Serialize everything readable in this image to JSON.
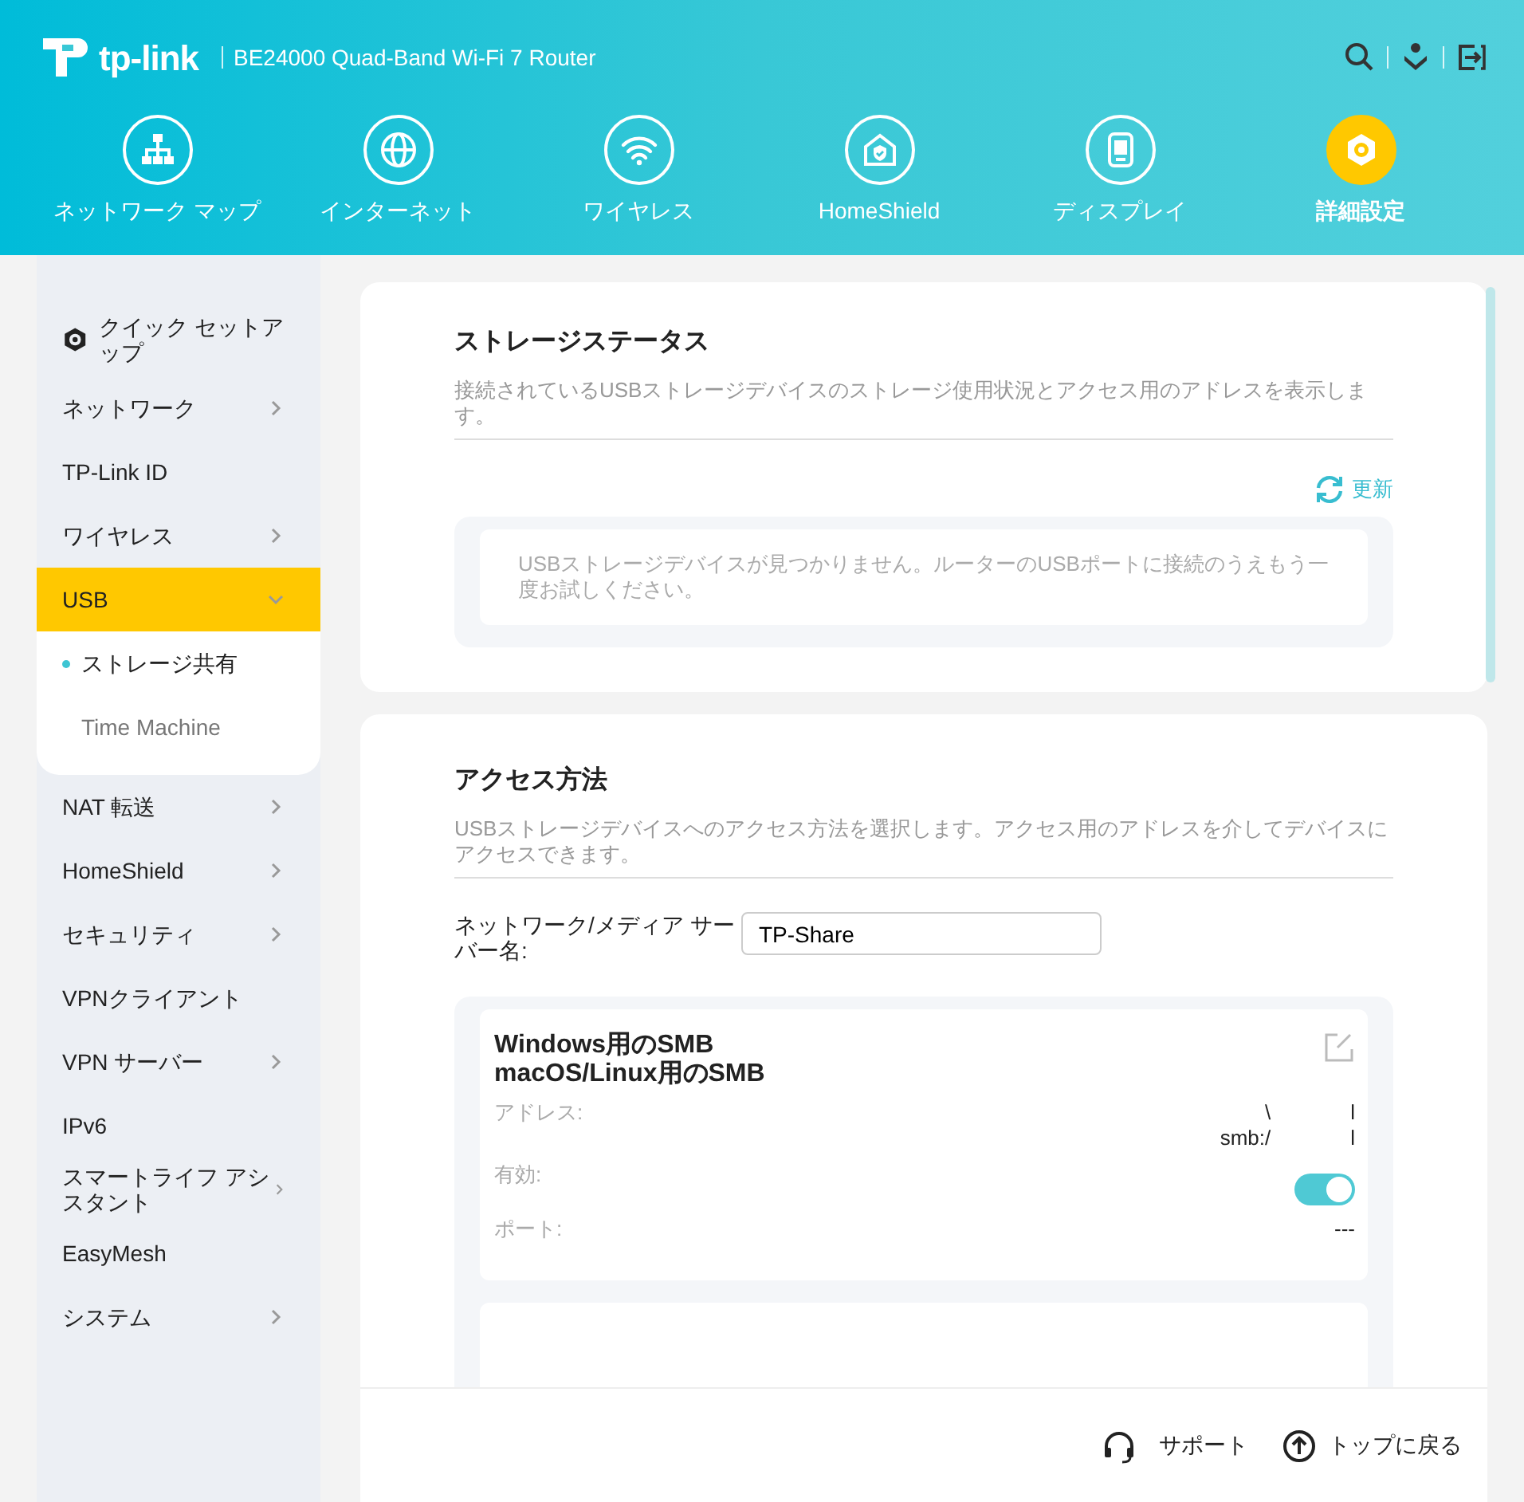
{
  "header": {
    "logo": "tp-link",
    "model": "BE24000 Quad-Band Wi-Fi 7 Router",
    "nav": [
      {
        "label": "ネットワーク マップ",
        "kind": "map",
        "selected": false
      },
      {
        "label": "インターネット",
        "kind": "globe",
        "selected": false
      },
      {
        "label": "ワイヤレス",
        "kind": "wifi",
        "selected": false
      },
      {
        "label": "HomeShield",
        "kind": "shield",
        "selected": false
      },
      {
        "label": "ディスプレイ",
        "kind": "display",
        "selected": false
      },
      {
        "label": "詳細設定",
        "kind": "gear",
        "selected": true
      }
    ]
  },
  "sidebar": {
    "items": [
      {
        "label": "クイック セットアップ",
        "kind": "setup"
      },
      {
        "label": "ネットワーク",
        "kind": "group",
        "expanded": false,
        "selected": false
      },
      {
        "label": "TP-Link ID",
        "kind": "link",
        "selected": false
      },
      {
        "label": "ワイヤレス",
        "kind": "group",
        "expanded": false,
        "selected": false
      },
      {
        "label": "USB",
        "kind": "group",
        "expanded": true,
        "selected": true,
        "children": [
          {
            "label": "ストレージ共有",
            "selected": true
          },
          {
            "label": "Time Machine",
            "selected": false
          }
        ]
      },
      {
        "label": "NAT 転送",
        "kind": "group",
        "expanded": false,
        "selected": false
      },
      {
        "label": "HomeShield",
        "kind": "group",
        "expanded": false,
        "selected": false
      },
      {
        "label": "セキュリティ",
        "kind": "group",
        "expanded": false,
        "selected": false
      },
      {
        "label": "VPNクライアント",
        "kind": "link",
        "selected": false
      },
      {
        "label": "VPN サーバー",
        "kind": "group",
        "expanded": false,
        "selected": false
      },
      {
        "label": "IPv6",
        "kind": "link",
        "selected": false
      },
      {
        "label": "スマートライフ アシスタント",
        "kind": "group",
        "expanded": false,
        "selected": false
      },
      {
        "label": "EasyMesh",
        "kind": "link",
        "selected": false
      },
      {
        "label": "システム",
        "kind": "group",
        "expanded": false,
        "selected": false
      }
    ]
  },
  "storage_status": {
    "title": "ストレージステータス",
    "description": "接続されているUSBストレージデバイスのストレージ使用状況とアクセス用のアドレスを表示します。",
    "refresh": "更新",
    "empty_message": "USBストレージデバイスが見つかりません。ルーターのUSBポートに接続のうえもう一度お試しください。"
  },
  "access_method": {
    "title": "アクセス方法",
    "description": "USBストレージデバイスへのアクセス方法を選択します。アクセス用のアドレスを介してデバイスにアクセスできます。",
    "server_name_label": "ネットワーク/メディア サーバー名:",
    "server_name": "TP-Share",
    "methods": [
      {
        "title_lines": [
          "Windows用のSMB",
          "macOS/Linux用のSMB"
        ],
        "address_label": "アドレス:",
        "address_lines": [
          [
            "\\",
            "l"
          ],
          [
            "smb:/",
            "l"
          ]
        ],
        "enabled_label": "有効:",
        "enabled": true,
        "port_label": "ポート:",
        "port": "---"
      }
    ]
  },
  "footer": {
    "support": "サポート",
    "back_to_top": "トップに戻る"
  }
}
